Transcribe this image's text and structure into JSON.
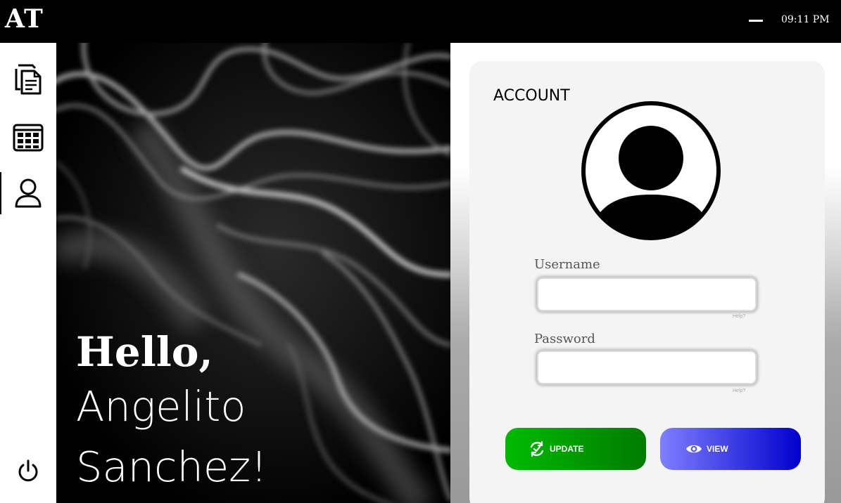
{
  "topbar": {
    "logo": "AT",
    "time": "09:11 PM"
  },
  "sidebar": {
    "items": [
      {
        "name": "documents",
        "icon": "documents-icon",
        "active": false
      },
      {
        "name": "grid",
        "icon": "grid-icon",
        "active": false
      },
      {
        "name": "account",
        "icon": "user-icon",
        "active": true
      }
    ],
    "power_icon": "power-icon"
  },
  "hero": {
    "hello": "Hello,",
    "first_name": "Angelito",
    "last_name": "Sanchez!"
  },
  "account": {
    "title": "ACCOUNT",
    "avatar_icon": "user-avatar-icon",
    "username_label": "Username",
    "username_value": "",
    "username_help": "Help?",
    "password_label": "Password",
    "password_value": "",
    "password_help": "Help?",
    "update_label": "UPDATE",
    "update_icon": "refresh-check-icon",
    "view_label": "VIEW",
    "view_icon": "eye-icon"
  },
  "colors": {
    "topbar": "#000000",
    "update_start": "#00bb00",
    "update_end": "#007a00",
    "view_start": "#7f7fff",
    "view_end": "#0000cc"
  }
}
